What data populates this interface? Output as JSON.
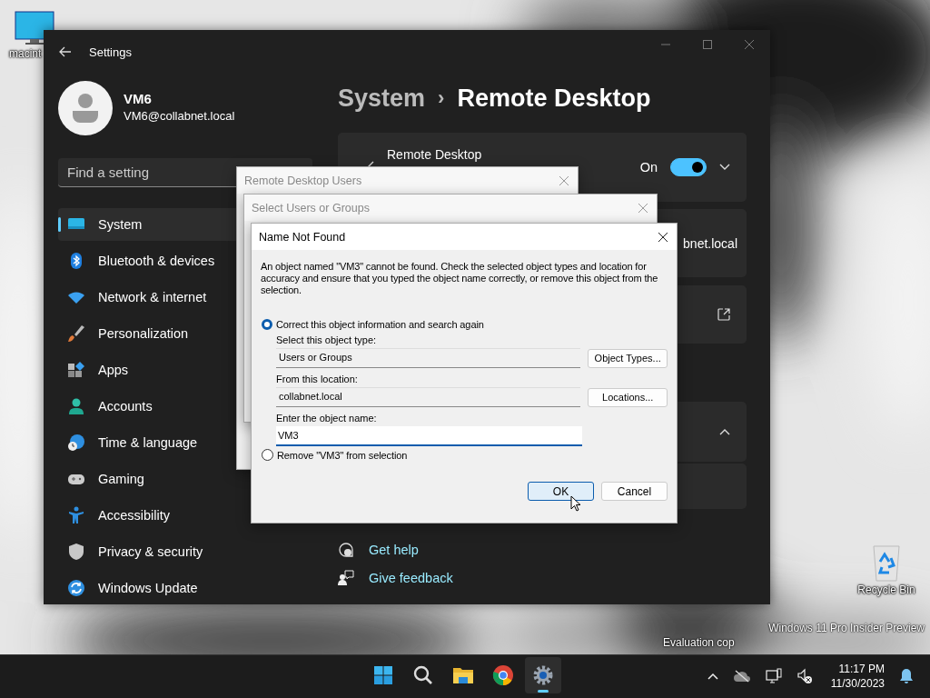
{
  "desktop": {
    "icons": [
      {
        "label": "macint"
      },
      {
        "label": "Recycle Bin"
      }
    ],
    "watermark": [
      "Windows 11 Pro Insider Preview",
      "Evaluation cop"
    ]
  },
  "settings": {
    "title": "Settings",
    "user": {
      "name": "VM6",
      "email": "VM6@collabnet.local"
    },
    "search": {
      "placeholder": "Find a setting"
    },
    "nav": [
      {
        "label": "System",
        "selected": true
      },
      {
        "label": "Bluetooth & devices",
        "selected": false
      },
      {
        "label": "Network & internet",
        "selected": false
      },
      {
        "label": "Personalization",
        "selected": false
      },
      {
        "label": "Apps",
        "selected": false
      },
      {
        "label": "Accounts",
        "selected": false
      },
      {
        "label": "Time & language",
        "selected": false
      },
      {
        "label": "Gaming",
        "selected": false
      },
      {
        "label": "Accessibility",
        "selected": false
      },
      {
        "label": "Privacy & security",
        "selected": false
      },
      {
        "label": "Windows Update",
        "selected": false
      }
    ],
    "breadcrumb": {
      "parent": "System",
      "separator": "›",
      "current": "Remote Desktop"
    },
    "remote_desktop": {
      "label": "Remote Desktop",
      "state": "On",
      "on": true
    },
    "computer_name": "bnet.local",
    "links": [
      "Get help",
      "Give feedback"
    ]
  },
  "dialogs": {
    "remote_desktop_users": {
      "title": "Remote Desktop Users"
    },
    "select_users": {
      "title": "Select Users or Groups"
    },
    "name_not_found": {
      "title": "Name Not Found",
      "message": "An object named \"VM3\" cannot be found. Check the selected object types and location for accuracy and ensure that you typed the object name correctly, or remove this object from the selection.",
      "options": [
        {
          "label": "Correct this object information and search again",
          "selected": true
        },
        {
          "label": "Remove \"VM3\" from selection",
          "selected": false
        }
      ],
      "object_type": {
        "label": "Select this object type:",
        "value": "Users or Groups",
        "button": "Object Types..."
      },
      "location": {
        "label": "From this location:",
        "value": "collabnet.local",
        "button": "Locations..."
      },
      "object_name": {
        "label": "Enter the object name:",
        "value": "VM3"
      },
      "buttons": [
        {
          "label": "OK",
          "default": true
        },
        {
          "label": "Cancel",
          "default": false
        }
      ]
    }
  },
  "taskbar": {
    "apps": [
      {
        "active": false
      },
      {
        "active": false
      },
      {
        "active": false
      },
      {
        "active": false
      },
      {
        "active": true
      }
    ],
    "time": "11:17 PM",
    "date": "11/30/2023"
  }
}
